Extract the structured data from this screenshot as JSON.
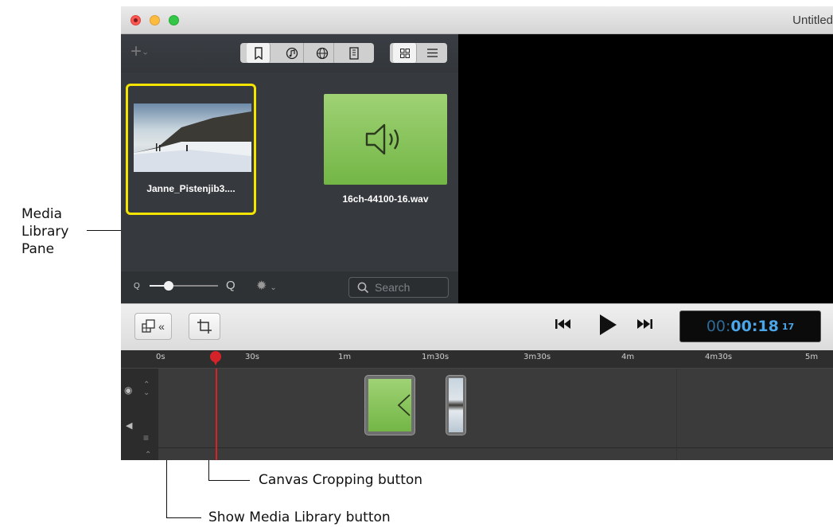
{
  "annotations": {
    "media_library_pane": [
      "Media",
      "Library",
      "Pane"
    ],
    "canvas_cropping": "Canvas Cropping button",
    "show_media_library": "Show Media Library button"
  },
  "window": {
    "title": "Untitled",
    "traffic_lights": {
      "close": "#fc5753",
      "minimize": "#fdbc40",
      "zoom": "#33c748"
    }
  },
  "library": {
    "add_icon": "plus-icon",
    "source_tabs": [
      "document-icon",
      "music-icon",
      "globe-icon",
      "film-icon"
    ],
    "view_modes": [
      "grid-icon",
      "list-icon"
    ],
    "items": [
      {
        "name": "Janne_Pistenjib3....",
        "kind": "video",
        "selected": true
      },
      {
        "name": "16ch-44100-16.wav",
        "kind": "audio"
      }
    ],
    "search_placeholder": "Search",
    "zoom_small": "Q",
    "zoom_large": "Q",
    "zoom_value": 0.28
  },
  "toolbar": {
    "timecode_dim": "00:",
    "timecode_main": "00:18",
    "timecode_frames": "17"
  },
  "timeline": {
    "ticks": [
      "0s",
      "30s",
      "1m",
      "1m30s",
      "3m30s",
      "4m",
      "4m30s",
      "5m"
    ]
  },
  "colors": {
    "selection": "#f5e400",
    "audio_green": "#7dbf4b",
    "playhead": "#d6232a",
    "timecode_text": "#4aa6e8"
  }
}
